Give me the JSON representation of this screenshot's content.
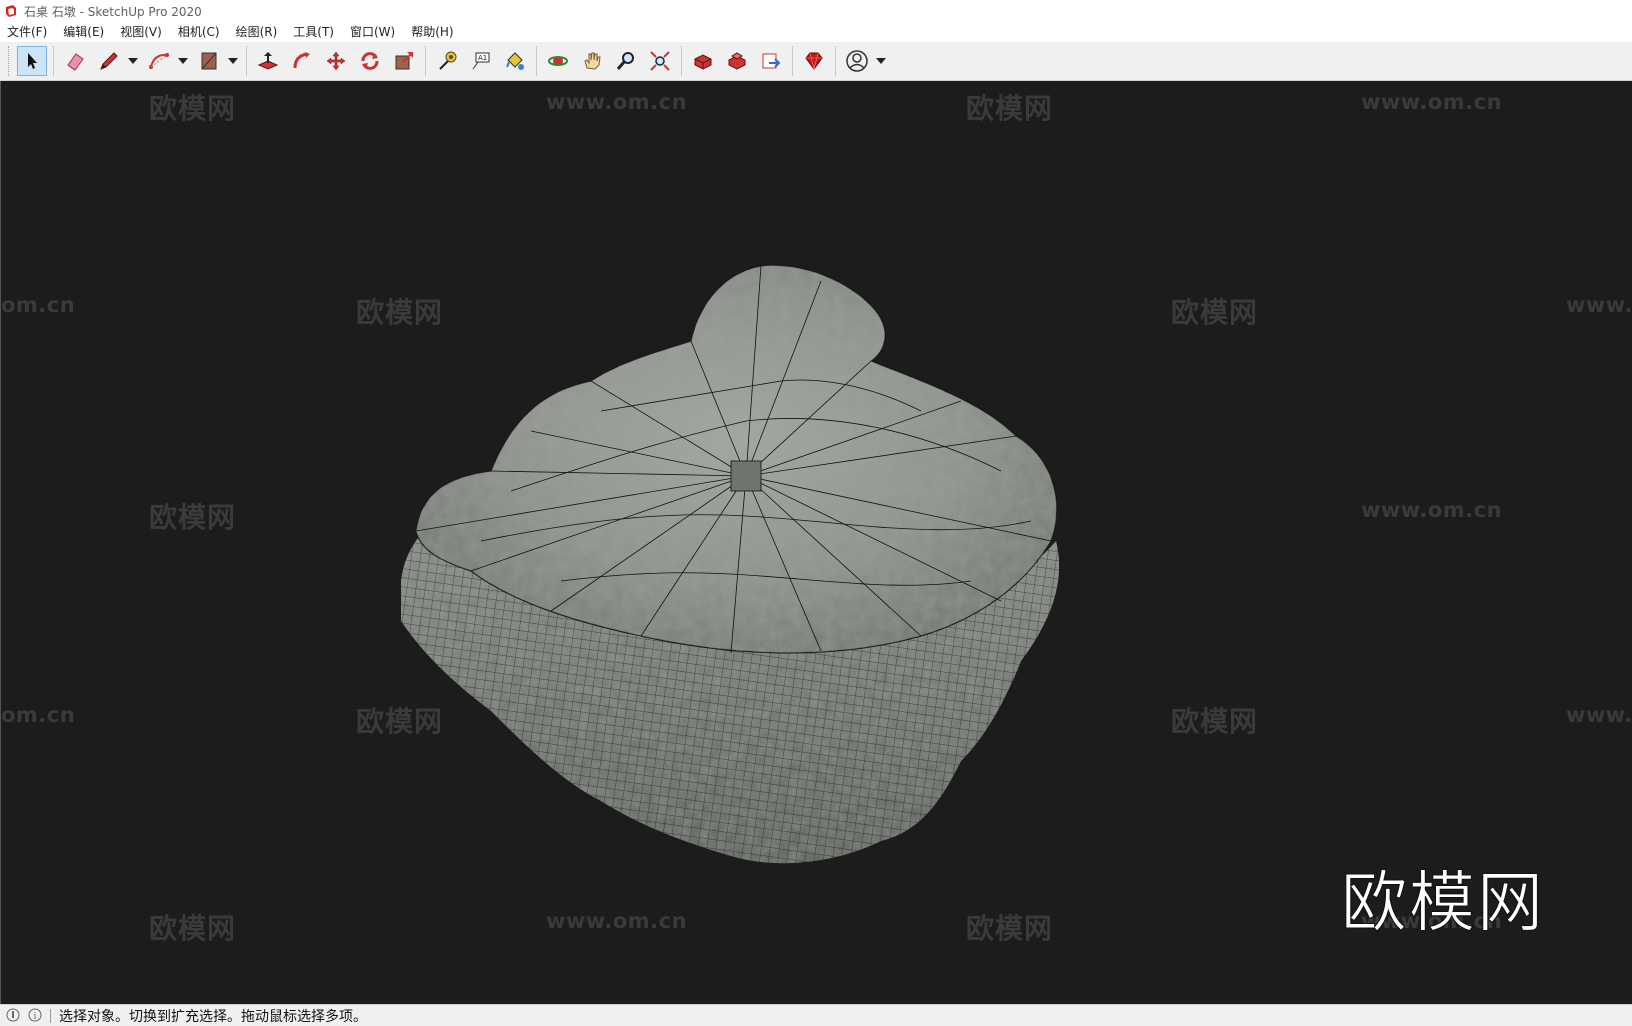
{
  "window": {
    "title": "石桌 石墩 - SketchUp Pro 2020"
  },
  "menu": [
    "文件(F)",
    "编辑(E)",
    "视图(V)",
    "相机(C)",
    "绘图(R)",
    "工具(T)",
    "窗口(W)",
    "帮助(H)"
  ],
  "toolbar": {
    "tools": [
      "select-icon",
      "eraser-icon",
      "pencil-icon",
      "arc-icon",
      "rectangle-icon",
      "push-pull-icon",
      "follow-me-icon",
      "move-icon",
      "rotate-icon",
      "scale-icon",
      "tape-measure-icon",
      "text-icon",
      "paint-bucket-icon",
      "orbit-icon",
      "pan-icon",
      "zoom-icon",
      "zoom-extents-icon",
      "3d-warehouse-icon",
      "extension-warehouse-icon",
      "layout-icon",
      "ruby-icon",
      "account-icon"
    ],
    "active_tool": "select-icon"
  },
  "watermarks": {
    "brand": "欧模网",
    "url": "www.om.cn",
    "url_left_partial": "om.cn",
    "url_right_partial": "www.",
    "big": "欧模网"
  },
  "status": {
    "hint": "选择对象。切换到扩充选择。拖动鼠标选择多项。"
  },
  "colors": {
    "viewport_bg": "#1c1c1c",
    "stone": "#8f958f",
    "accent": "#cce4f7"
  }
}
